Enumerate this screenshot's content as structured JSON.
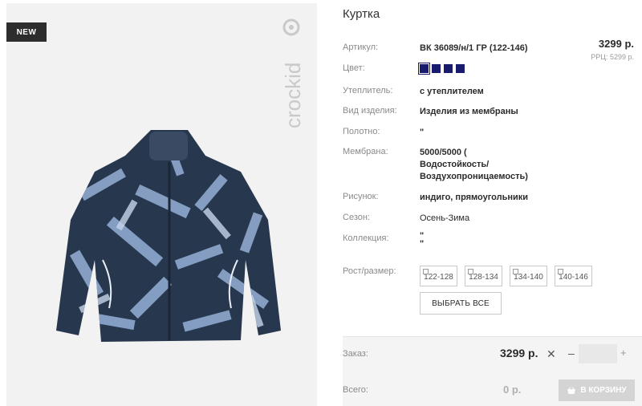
{
  "badge": "NEW",
  "brand": "crockid",
  "product": {
    "title": "Куртка",
    "price": "3299 р.",
    "rrp": "РРЦ: 5299 р.",
    "rows": {
      "article": {
        "label": "Артикул:",
        "value": "ВК 36089/н/1 ГР (122-146)"
      },
      "color": {
        "label": "Цвет:"
      },
      "insulation": {
        "label": "Утеплитель:",
        "value": "с утеплителем"
      },
      "kind": {
        "label": "Вид изделия:",
        "value": "Изделия из мембраны"
      },
      "fabric": {
        "label": "Полотно:",
        "value": "\""
      },
      "membrane": {
        "label": "Мембрана:",
        "value_lines": [
          "5000/5000 (",
          "Водостойкость/",
          "Воздухопроницаемость)"
        ]
      },
      "pattern": {
        "label": "Рисунок:",
        "value": "индиго, прямоугольники"
      },
      "season": {
        "label": "Сезон:",
        "value": "Осень-Зима"
      },
      "collection": {
        "label": "Коллекция:",
        "value_lines": [
          "\"",
          "\""
        ]
      },
      "size": {
        "label": "Рост/размер:"
      }
    },
    "swatch_color": "#1a1a6e",
    "sizes": [
      "122-128",
      "128-134",
      "134-140",
      "140-146"
    ],
    "select_all": "ВЫБРАТЬ ВСЕ"
  },
  "order": {
    "label": "Заказ:",
    "price": "3299 р.",
    "minus": "–",
    "plus": "+",
    "total_label": "Всего:",
    "total_value": "0 р.",
    "cart_button": "В КОРЗИНУ"
  }
}
